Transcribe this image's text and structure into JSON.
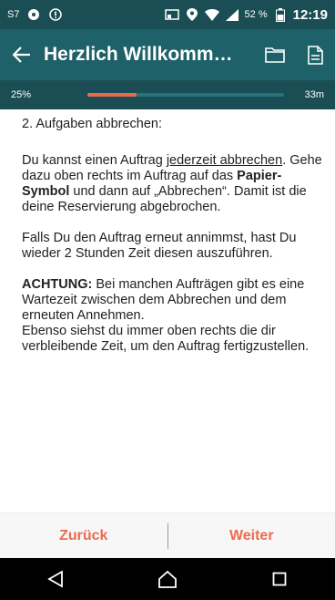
{
  "status_bar": {
    "left_text": "S7",
    "icons": [
      "soccer-icon",
      "alert-icon"
    ],
    "right_icons": [
      "cast-icon",
      "location-icon",
      "wifi-icon",
      "signal-icon",
      "battery-icon"
    ],
    "battery": "52 %",
    "time": "12:19"
  },
  "app_bar": {
    "title": "Herzlich Willkomm…",
    "icons": [
      "back-arrow-icon",
      "folder-icon",
      "document-icon"
    ]
  },
  "progress": {
    "percent_label": "25%",
    "time_left": "33m",
    "fill_fraction": 0.25
  },
  "content": {
    "heading": "2. Aufgaben abbrechen:",
    "p1_before": "Du kannst einen Auftrag ",
    "p1_link": "jederzeit abbrechen",
    "p1_mid": ". Gehe dazu oben rechts im Auftrag auf das ",
    "p1_bold": "Papier-Symbol",
    "p1_after": " und dann auf „Abbrechen“. Damit ist die deine Reservierung abgebrochen.",
    "p2": "Falls Du den Auftrag erneut annimmst, hast Du wieder 2 Stunden Zeit diesen auszuführen.",
    "p3_bold": "ACHTUNG:",
    "p3_rest": " Bei manchen Aufträgen gibt es eine Wartezeit zwischen dem Abbrechen und dem erneuten Annehmen.",
    "p3_line2": "Ebenso siehst du immer oben rechts die dir verbleibende Zeit, um den Auftrag fertigzustellen."
  },
  "actions": {
    "back_label": "Zurück",
    "next_label": "Weiter"
  },
  "colors": {
    "primary": "#1f6168",
    "primary_dark": "#1b4e54",
    "accent": "#ee6a4e"
  }
}
